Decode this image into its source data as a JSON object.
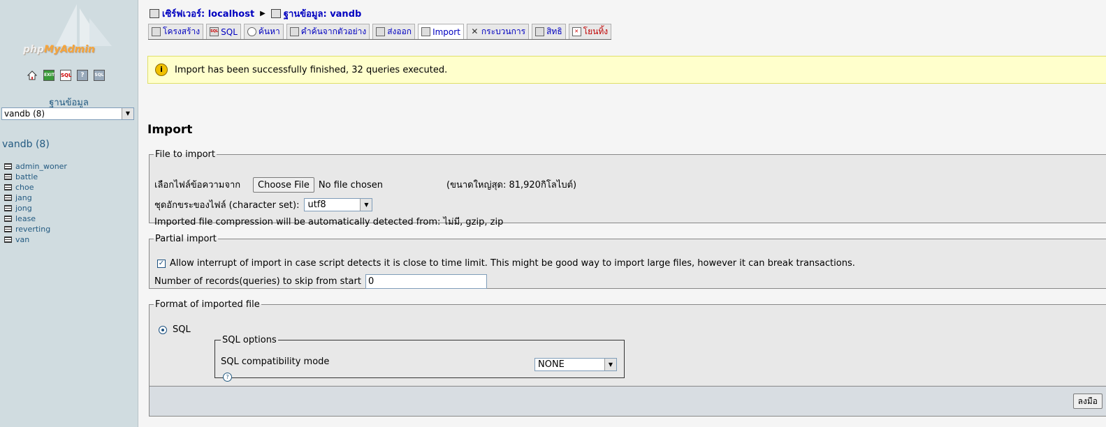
{
  "left": {
    "logo": {
      "prefix": "php",
      "highlight": "MyAdmin"
    },
    "icons": [
      "home-icon",
      "exit-icon",
      "sql-query-icon",
      "documentation-icon",
      "sql-docs-icon"
    ],
    "database_label": "ฐานข้อมูล",
    "database_select": "vandb (8)",
    "database_heading": "vandb (8)",
    "tables": [
      "admin_woner",
      "battle",
      "choe",
      "jang",
      "jong",
      "lease",
      "reverting",
      "van"
    ]
  },
  "breadcrumb": {
    "server": "เซิร์ฟเวอร์: localhost",
    "database": "ฐานข้อมูล: vandb"
  },
  "tabs": [
    {
      "label": "โครงสร้าง",
      "icon": "structure-icon"
    },
    {
      "label": "SQL",
      "icon": "sql-icon"
    },
    {
      "label": "ค้นหา",
      "icon": "search-icon"
    },
    {
      "label": "คำค้นจากตัวอย่าง",
      "icon": "query-icon"
    },
    {
      "label": "ส่งออก",
      "icon": "export-icon"
    },
    {
      "label": "Import",
      "icon": "import-icon",
      "active": true
    },
    {
      "label": "กระบวนการ",
      "icon": "operations-icon"
    },
    {
      "label": "สิทธิ",
      "icon": "privileges-icon"
    },
    {
      "label": "โยนทิ้ง",
      "icon": "drop-icon",
      "danger": true
    }
  ],
  "notice": {
    "text": "Import has been successfully finished, 32 queries executed."
  },
  "page_title": "Import",
  "file_to_import": {
    "legend": "File to import",
    "file_label": "เลือกไฟล์ข้อความจาก",
    "choose_button": "Choose File",
    "no_file": "No file chosen",
    "max_size": "(ขนาดใหญ่สุด: 81,920กิโลไบต์)",
    "charset_label": "ชุดอักขระของไฟล์ (character set):",
    "charset_value": "utf8",
    "compression_note": "Imported file compression will be automatically detected from: ไม่มี, gzip, zip"
  },
  "partial_import": {
    "legend": "Partial import",
    "allow_interrupt": "Allow interrupt of import in case script detects it is close to time limit. This might be good way to import large files, however it can break transactions.",
    "allow_interrupt_checked": true,
    "skip_label": "Number of records(queries) to skip from start",
    "skip_value": "0"
  },
  "format": {
    "legend": "Format of imported file",
    "format_name": "SQL",
    "options_legend": "SQL options",
    "compat_label": "SQL compatibility mode",
    "compat_value": "NONE"
  },
  "submit": {
    "label": "ลงมือ"
  },
  "colors": {
    "link": "#0000c0",
    "left_bg": "#d0dce0",
    "notice_bg": "#ffffcc"
  }
}
